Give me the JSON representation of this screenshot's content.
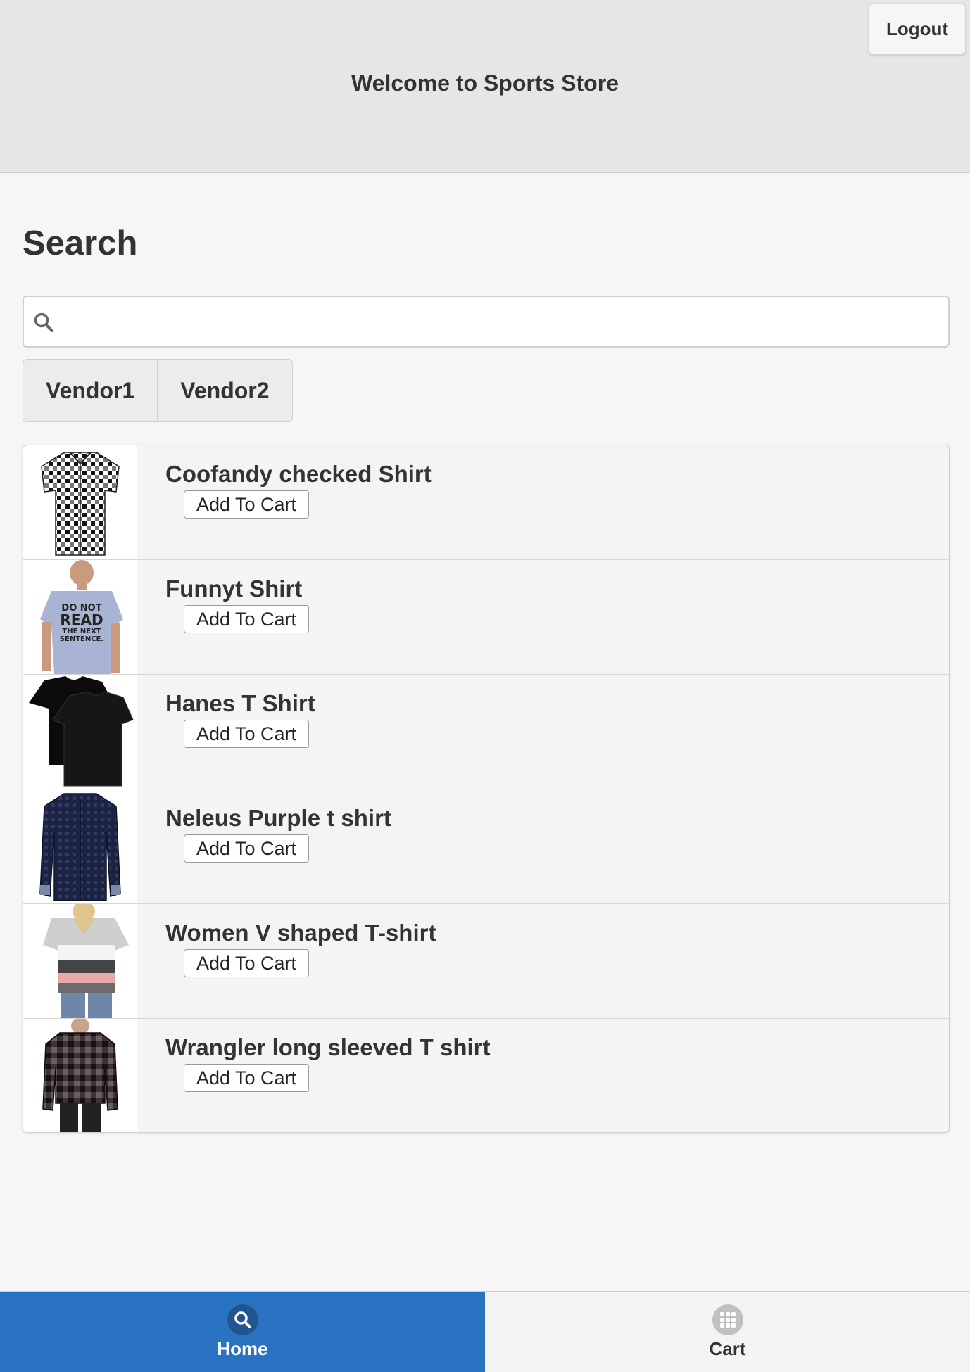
{
  "header": {
    "title": "Welcome to Sports Store",
    "logout_label": "Logout"
  },
  "search": {
    "heading": "Search",
    "placeholder": "",
    "value": ""
  },
  "vendors": [
    "Vendor1",
    "Vendor2"
  ],
  "products": [
    {
      "name": "Coofandy checked Shirt",
      "button": "Add To Cart"
    },
    {
      "name": "Funnyt Shirt",
      "button": "Add To Cart"
    },
    {
      "name": "Hanes T Shirt",
      "button": "Add To Cart"
    },
    {
      "name": "Neleus Purple t shirt",
      "button": "Add To Cart"
    },
    {
      "name": "Women V shaped T-shirt",
      "button": "Add To Cart"
    },
    {
      "name": "Wrangler long sleeved T shirt",
      "button": "Add To Cart"
    }
  ],
  "tshirt_print": {
    "line1": "DO NOT",
    "line2": "READ",
    "line3": "THE NEXT",
    "line4": "SENTENCE."
  },
  "navbar": {
    "home_label": "Home",
    "cart_label": "Cart",
    "home_icon": "search-icon",
    "cart_icon": "grid-icon",
    "active_color": "#2a73c2"
  }
}
